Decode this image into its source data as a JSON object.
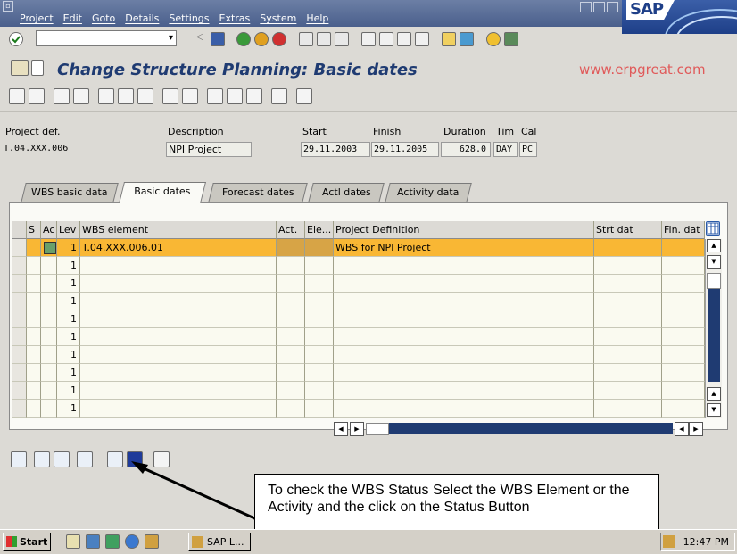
{
  "menubar": {
    "items": [
      "Project",
      "Edit",
      "Goto",
      "Details",
      "Settings",
      "Extras",
      "System",
      "Help"
    ]
  },
  "brand": {
    "logo_text": "SAP"
  },
  "toolbar": {
    "command_value": ""
  },
  "screen": {
    "title": "Change Structure Planning: Basic dates",
    "watermark": "www.erpgreat.com"
  },
  "header": {
    "labels": {
      "project_def": "Project def.",
      "description": "Description",
      "start": "Start",
      "finish": "Finish",
      "duration": "Duration",
      "unit": "Tim",
      "calendar": "Cal"
    },
    "values": {
      "project_def": "T.04.XXX.006",
      "description": "NPI Project",
      "start": "29.11.2003",
      "finish": "29.11.2005",
      "duration": "628.0",
      "unit": "DAY",
      "calendar": "PC"
    }
  },
  "tabs": [
    {
      "label": "WBS basic data",
      "active": false
    },
    {
      "label": "Basic dates",
      "active": true
    },
    {
      "label": "Forecast dates",
      "active": false
    },
    {
      "label": "Actl dates",
      "active": false
    },
    {
      "label": "Activity data",
      "active": false
    }
  ],
  "table": {
    "columns": [
      "S",
      "Ac",
      "Lev",
      "WBS element",
      "Act.",
      "Ele...",
      "Project Definition",
      "Strt dat",
      "Fin. dat"
    ],
    "rows": [
      {
        "lev": "1",
        "wbs": "T.04.XXX.006.01",
        "project_definition": "WBS for NPI Project"
      },
      {
        "lev": "1",
        "wbs": "",
        "project_definition": ""
      },
      {
        "lev": "1",
        "wbs": "",
        "project_definition": ""
      },
      {
        "lev": "1",
        "wbs": "",
        "project_definition": ""
      },
      {
        "lev": "1",
        "wbs": "",
        "project_definition": ""
      },
      {
        "lev": "1",
        "wbs": "",
        "project_definition": ""
      },
      {
        "lev": "1",
        "wbs": "",
        "project_definition": ""
      },
      {
        "lev": "1",
        "wbs": "",
        "project_definition": ""
      },
      {
        "lev": "1",
        "wbs": "",
        "project_definition": ""
      },
      {
        "lev": "1",
        "wbs": "",
        "project_definition": ""
      }
    ]
  },
  "callout": {
    "text": "To check the WBS Status Select the WBS Element or the Activity and the click on the Status Button"
  },
  "taskbar": {
    "start_label": "Start",
    "app_label": "SAP L...",
    "clock": "12:47 PM"
  },
  "colors": {
    "menubar": "#4a5f8c",
    "title": "#1f3b72",
    "watermark": "#e05a5a",
    "selected_row": "#f9b734",
    "scroll_track": "#1f3b72"
  }
}
